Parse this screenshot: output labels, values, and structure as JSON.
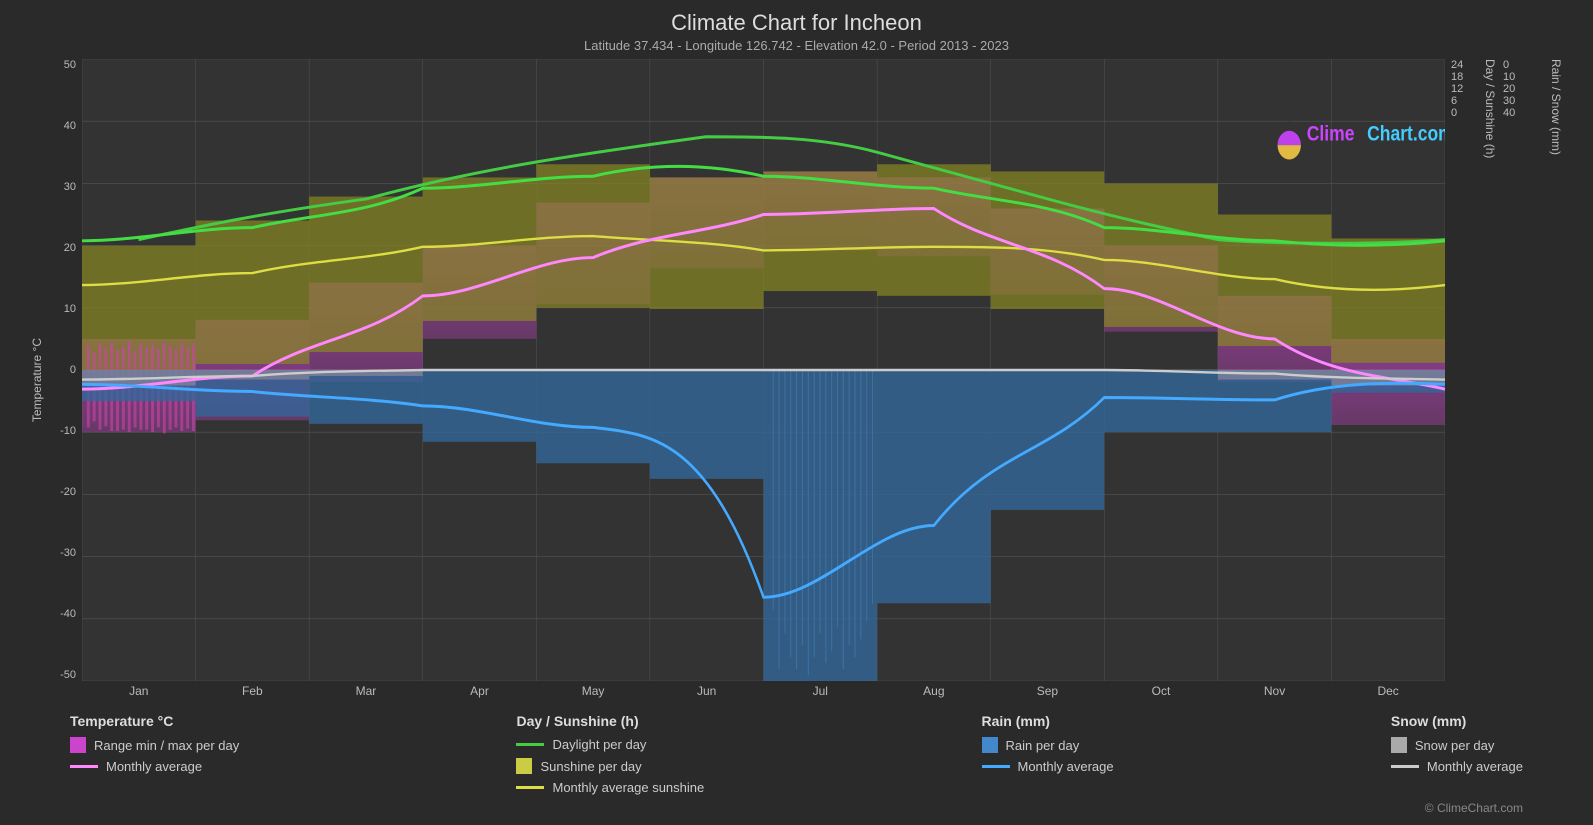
{
  "title": "Climate Chart for Incheon",
  "subtitle": "Latitude 37.434 - Longitude 126.742 - Elevation 42.0 - Period 2013 - 2023",
  "watermark": "© ClimeChart.com",
  "website": "ClimeChart.com",
  "y_axis_left": {
    "label": "Temperature °C",
    "values": [
      "50",
      "40",
      "30",
      "20",
      "10",
      "0",
      "-10",
      "-20",
      "-30",
      "-40",
      "-50"
    ]
  },
  "y_axis_right_top": {
    "label": "Day / Sunshine (h)",
    "values": [
      "24",
      "18",
      "12",
      "6",
      "0"
    ]
  },
  "y_axis_right_bottom": {
    "label": "Rain / Snow (mm)",
    "values": [
      "0",
      "10",
      "20",
      "30",
      "40"
    ]
  },
  "x_axis": {
    "labels": [
      "Jan",
      "Feb",
      "Mar",
      "Apr",
      "May",
      "Jun",
      "Jul",
      "Aug",
      "Sep",
      "Oct",
      "Nov",
      "Dec"
    ]
  },
  "legend": {
    "temperature": {
      "title": "Temperature °C",
      "items": [
        {
          "label": "Range min / max per day",
          "type": "swatch",
          "color": "#cc44cc"
        },
        {
          "label": "Monthly average",
          "type": "line",
          "color": "#ff88ff"
        }
      ]
    },
    "sunshine": {
      "title": "Day / Sunshine (h)",
      "items": [
        {
          "label": "Daylight per day",
          "type": "line",
          "color": "#44cc44"
        },
        {
          "label": "Sunshine per day",
          "type": "swatch",
          "color": "#cccc44"
        },
        {
          "label": "Monthly average sunshine",
          "type": "line",
          "color": "#dddd44"
        }
      ]
    },
    "rain": {
      "title": "Rain (mm)",
      "items": [
        {
          "label": "Rain per day",
          "type": "swatch",
          "color": "#4488cc"
        },
        {
          "label": "Monthly average",
          "type": "line",
          "color": "#44aaff"
        }
      ]
    },
    "snow": {
      "title": "Snow (mm)",
      "items": [
        {
          "label": "Snow per day",
          "type": "swatch",
          "color": "#aaaaaa"
        },
        {
          "label": "Monthly average",
          "type": "line",
          "color": "#cccccc"
        }
      ]
    }
  }
}
